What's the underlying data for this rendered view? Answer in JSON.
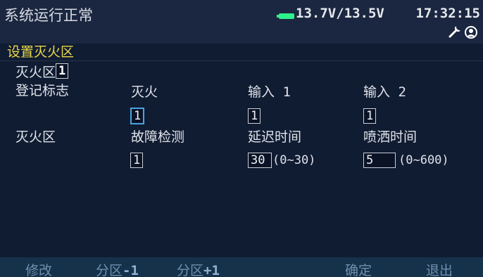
{
  "status": {
    "system_text": "系统运行正常",
    "voltage": "13.7V/13.5V",
    "time": "17:32:15",
    "battery_color": "#2ff08a",
    "icons": [
      "battery-icon",
      "wrench-icon",
      "service-icon"
    ]
  },
  "page": {
    "title": "设置灭火区"
  },
  "zone": {
    "label": "灭火区",
    "value": "1"
  },
  "registration": {
    "label": "登记标志",
    "columns": [
      {
        "header": "灭火",
        "value": "1"
      },
      {
        "header": "输入 1",
        "value": "1"
      },
      {
        "header": "输入 2",
        "value": "1"
      }
    ]
  },
  "extinguish": {
    "label": "灭火区",
    "fault_detect": {
      "header": "故障检测",
      "value": "1"
    },
    "delay": {
      "header": "延迟时间",
      "value": "30",
      "range": "(0~30)"
    },
    "spray": {
      "header": "喷洒时间",
      "value": "5",
      "range": "(0~600)"
    }
  },
  "softkeys": {
    "modify": "修改",
    "zone_minus_text": "分区",
    "zone_minus_num": "-1",
    "zone_plus_text": "分区",
    "zone_plus_num": "+1",
    "confirm": "确定",
    "exit": "退出"
  }
}
